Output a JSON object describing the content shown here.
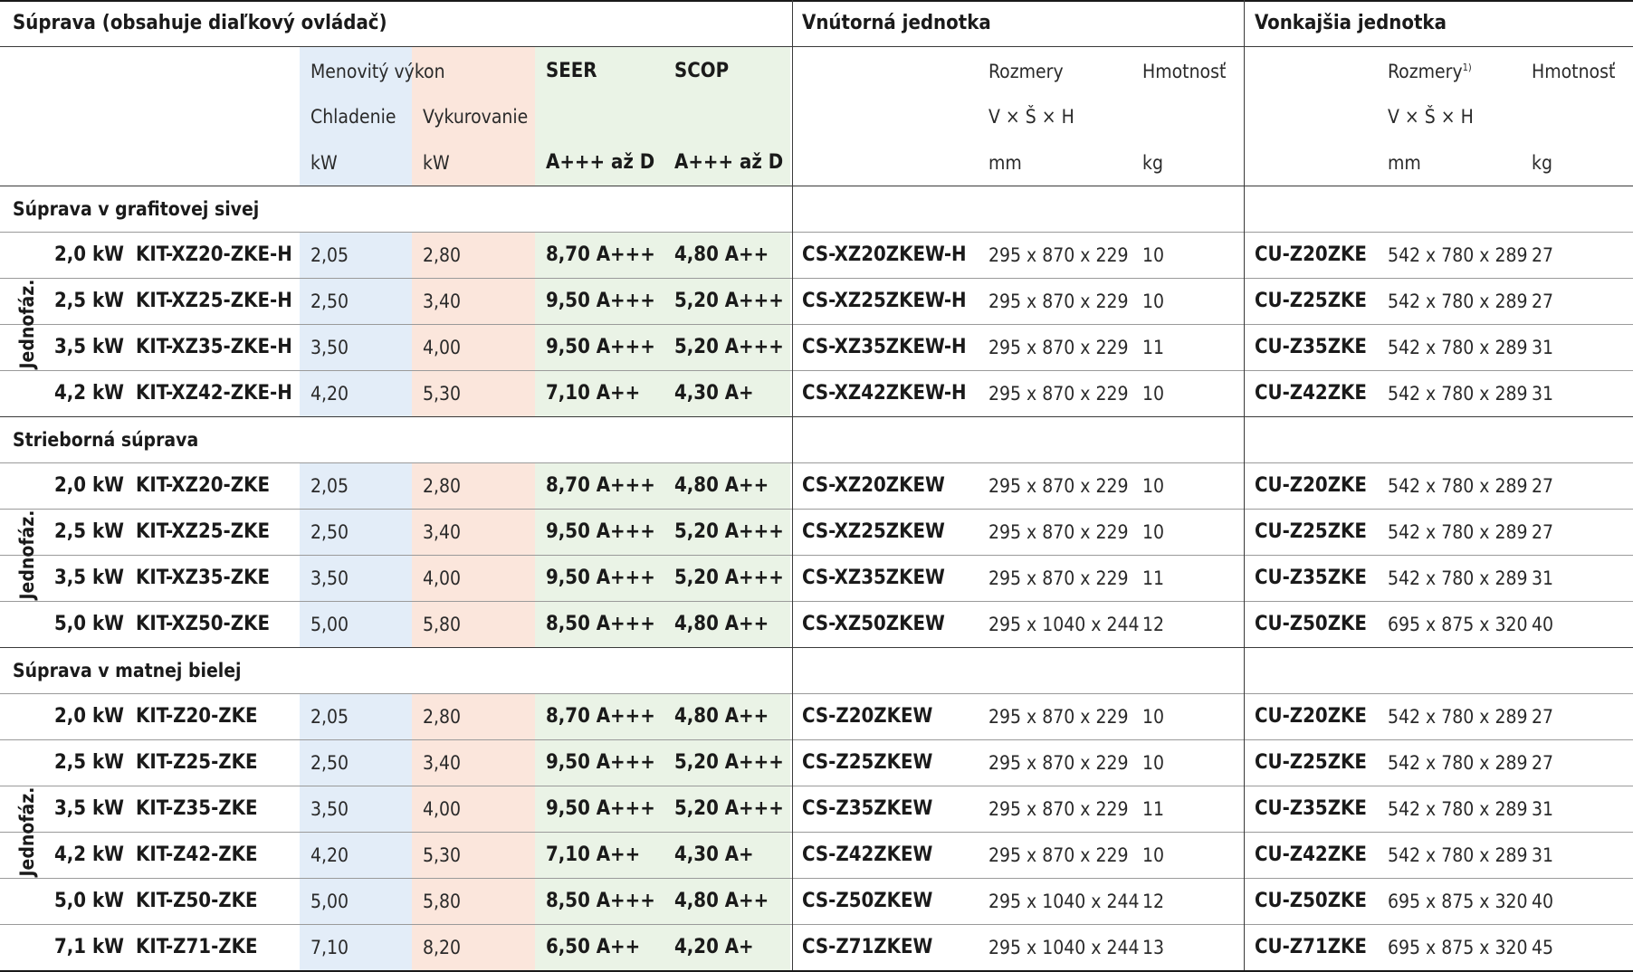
{
  "header": {
    "set_title": "Súprava (obsahuje diaľkový ovládač)",
    "indoor_title": "Vnútorná jednotka",
    "outdoor_title": "Vonkajšia jednotka",
    "rated_output": "Menovitý výkon",
    "cooling": "Chladenie",
    "heating": "Vykurovanie",
    "kw": "kW",
    "seer": "SEER",
    "scop": "SCOP",
    "energy_class": "A+++ až D",
    "dimensions": "Rozmery",
    "dimensions_note": "1)",
    "dims_formula": "V × Š × H",
    "mm": "mm",
    "weight": "Hmotnosť",
    "kg": "kg"
  },
  "phase_label": "Jednofáz.",
  "sections": [
    {
      "title": "Súprava v grafitovej sivej",
      "rows": [
        {
          "power": "2,0 kW",
          "kit": "KIT-XZ20-ZKE-H",
          "cool": "2,05",
          "heat": "2,80",
          "seer": "8,70 A+++",
          "scop": "4,80 A++",
          "indoor": "CS-XZ20ZKEW-H",
          "in_dims": "295 x 870 x 229",
          "in_kg": "10",
          "outdoor": "CU-Z20ZKE",
          "out_dims": "542 x 780 x 289",
          "out_kg": "27"
        },
        {
          "power": "2,5 kW",
          "kit": "KIT-XZ25-ZKE-H",
          "cool": "2,50",
          "heat": "3,40",
          "seer": "9,50 A+++",
          "scop": "5,20 A+++",
          "indoor": "CS-XZ25ZKEW-H",
          "in_dims": "295 x 870 x 229",
          "in_kg": "10",
          "outdoor": "CU-Z25ZKE",
          "out_dims": "542 x 780 x 289",
          "out_kg": "27"
        },
        {
          "power": "3,5 kW",
          "kit": "KIT-XZ35-ZKE-H",
          "cool": "3,50",
          "heat": "4,00",
          "seer": "9,50 A+++",
          "scop": "5,20 A+++",
          "indoor": "CS-XZ35ZKEW-H",
          "in_dims": "295 x 870 x 229",
          "in_kg": "11",
          "outdoor": "CU-Z35ZKE",
          "out_dims": "542 x 780 x 289",
          "out_kg": "31"
        },
        {
          "power": "4,2 kW",
          "kit": "KIT-XZ42-ZKE-H",
          "cool": "4,20",
          "heat": "5,30",
          "seer": "7,10 A++",
          "scop": "4,30 A+",
          "indoor": "CS-XZ42ZKEW-H",
          "in_dims": "295 x 870 x 229",
          "in_kg": "10",
          "outdoor": "CU-Z42ZKE",
          "out_dims": "542 x 780 x 289",
          "out_kg": "31"
        }
      ]
    },
    {
      "title": "Strieborná súprava",
      "rows": [
        {
          "power": "2,0 kW",
          "kit": "KIT-XZ20-ZKE",
          "cool": "2,05",
          "heat": "2,80",
          "seer": "8,70 A+++",
          "scop": "4,80 A++",
          "indoor": "CS-XZ20ZKEW",
          "in_dims": "295 x 870 x 229",
          "in_kg": "10",
          "outdoor": "CU-Z20ZKE",
          "out_dims": "542 x 780 x 289",
          "out_kg": "27"
        },
        {
          "power": "2,5 kW",
          "kit": "KIT-XZ25-ZKE",
          "cool": "2,50",
          "heat": "3,40",
          "seer": "9,50 A+++",
          "scop": "5,20 A+++",
          "indoor": "CS-XZ25ZKEW",
          "in_dims": "295 x 870 x 229",
          "in_kg": "10",
          "outdoor": "CU-Z25ZKE",
          "out_dims": "542 x 780 x 289",
          "out_kg": "27"
        },
        {
          "power": "3,5 kW",
          "kit": "KIT-XZ35-ZKE",
          "cool": "3,50",
          "heat": "4,00",
          "seer": "9,50 A+++",
          "scop": "5,20 A+++",
          "indoor": "CS-XZ35ZKEW",
          "in_dims": "295 x 870 x 229",
          "in_kg": "11",
          "outdoor": "CU-Z35ZKE",
          "out_dims": "542 x 780 x 289",
          "out_kg": "31"
        },
        {
          "power": "5,0 kW",
          "kit": "KIT-XZ50-ZKE",
          "cool": "5,00",
          "heat": "5,80",
          "seer": "8,50 A+++",
          "scop": "4,80 A++",
          "indoor": "CS-XZ50ZKEW",
          "in_dims": "295 x 1040 x 244",
          "in_kg": "12",
          "outdoor": "CU-Z50ZKE",
          "out_dims": "695 x 875 x 320",
          "out_kg": "40"
        }
      ]
    },
    {
      "title": "Súprava v matnej bielej",
      "rows": [
        {
          "power": "2,0 kW",
          "kit": "KIT-Z20-ZKE",
          "cool": "2,05",
          "heat": "2,80",
          "seer": "8,70 A+++",
          "scop": "4,80 A++",
          "indoor": "CS-Z20ZKEW",
          "in_dims": "295 x 870 x 229",
          "in_kg": "10",
          "outdoor": "CU-Z20ZKE",
          "out_dims": "542 x 780 x 289",
          "out_kg": "27"
        },
        {
          "power": "2,5 kW",
          "kit": "KIT-Z25-ZKE",
          "cool": "2,50",
          "heat": "3,40",
          "seer": "9,50 A+++",
          "scop": "5,20 A+++",
          "indoor": "CS-Z25ZKEW",
          "in_dims": "295 x 870 x 229",
          "in_kg": "10",
          "outdoor": "CU-Z25ZKE",
          "out_dims": "542 x 780 x 289",
          "out_kg": "27"
        },
        {
          "power": "3,5 kW",
          "kit": "KIT-Z35-ZKE",
          "cool": "3,50",
          "heat": "4,00",
          "seer": "9,50 A+++",
          "scop": "5,20 A+++",
          "indoor": "CS-Z35ZKEW",
          "in_dims": "295 x 870 x 229",
          "in_kg": "11",
          "outdoor": "CU-Z35ZKE",
          "out_dims": "542 x 780 x 289",
          "out_kg": "31"
        },
        {
          "power": "4,2 kW",
          "kit": "KIT-Z42-ZKE",
          "cool": "4,20",
          "heat": "5,30",
          "seer": "7,10 A++",
          "scop": "4,30 A+",
          "indoor": "CS-Z42ZKEW",
          "in_dims": "295 x 870 x 229",
          "in_kg": "10",
          "outdoor": "CU-Z42ZKE",
          "out_dims": "542 x 780 x 289",
          "out_kg": "31"
        },
        {
          "power": "5,0 kW",
          "kit": "KIT-Z50-ZKE",
          "cool": "5,00",
          "heat": "5,80",
          "seer": "8,50 A+++",
          "scop": "4,80 A++",
          "indoor": "CS-Z50ZKEW",
          "in_dims": "295 x 1040 x 244",
          "in_kg": "12",
          "outdoor": "CU-Z50ZKE",
          "out_dims": "695 x 875 x 320",
          "out_kg": "40"
        },
        {
          "power": "7,1 kW",
          "kit": "KIT-Z71-ZKE",
          "cool": "7,10",
          "heat": "8,20",
          "seer": "6,50 A++",
          "scop": "4,20 A+",
          "indoor": "CS-Z71ZKEW",
          "in_dims": "295 x 1040 x 244",
          "in_kg": "13",
          "outdoor": "CU-Z71ZKE",
          "out_dims": "695 x 875 x 320",
          "out_kg": "45"
        }
      ]
    }
  ]
}
